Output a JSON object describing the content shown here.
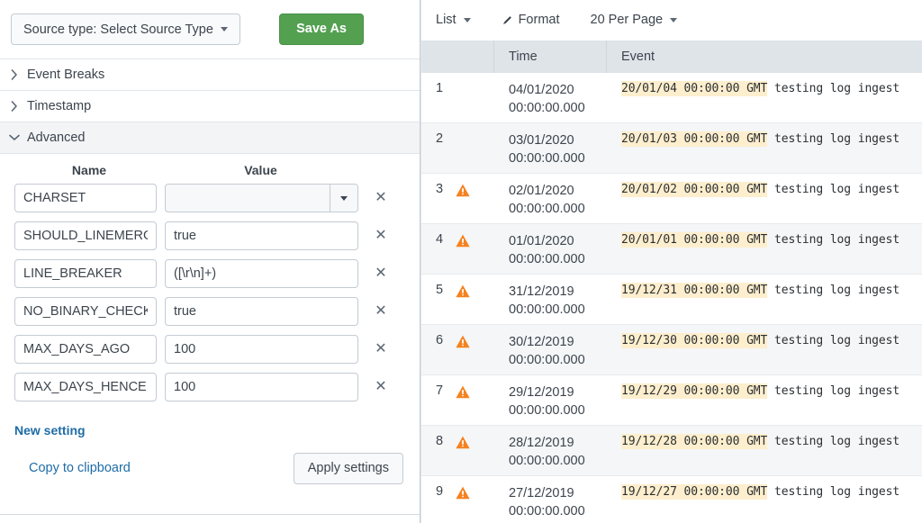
{
  "left_panel": {
    "source_type": {
      "label": "Source type: Select Source Type",
      "caret_icon": "chevron-down-icon"
    },
    "save_as_label": "Save As",
    "accent_green": "#53a051",
    "link_blue": "#1e6ca6",
    "accordion": [
      {
        "label": "Event Breaks",
        "expanded": false,
        "icon": "chevron-right-icon"
      },
      {
        "label": "Timestamp",
        "expanded": false,
        "icon": "chevron-right-icon"
      },
      {
        "label": "Advanced",
        "expanded": true,
        "icon": "chevron-down-icon"
      }
    ],
    "advanced": {
      "col_name_header": "Name",
      "col_value_header": "Value",
      "remove_icon": "close-icon",
      "dropdown_icon": "chevron-down-icon",
      "settings": [
        {
          "name": "CHARSET",
          "value": "",
          "type": "select"
        },
        {
          "name": "SHOULD_LINEMERGE",
          "value": "true",
          "type": "text"
        },
        {
          "name": "LINE_BREAKER",
          "value": "([\\r\\n]+)",
          "type": "text"
        },
        {
          "name": "NO_BINARY_CHECK",
          "value": "true",
          "type": "text"
        },
        {
          "name": "MAX_DAYS_AGO",
          "value": "100",
          "type": "text"
        },
        {
          "name": "MAX_DAYS_HENCE",
          "value": "100",
          "type": "text"
        }
      ],
      "new_setting_label": "New setting",
      "copy_to_clipboard_label": "Copy to clipboard",
      "apply_settings_label": "Apply settings"
    }
  },
  "right_panel": {
    "toolbar": {
      "view_mode": "List",
      "view_mode_icon": "chevron-down-icon",
      "format_label": "Format",
      "format_icon": "pencil-icon",
      "per_page": "20 Per Page",
      "per_page_icon": "chevron-down-icon"
    },
    "table": {
      "columns": [
        "",
        "",
        "Time",
        "Event"
      ],
      "warning_icon": "warning-triangle-icon",
      "warning_color": "#f58220",
      "highlight_color": "#fdeecd",
      "rows": [
        {
          "num": "1",
          "warning": false,
          "time_date": "04/01/2020",
          "time_clock": "00:00:00.000",
          "event_ts": "20/01/04 00:00:00 GMT",
          "event_msg": "testing log ingest"
        },
        {
          "num": "2",
          "warning": false,
          "time_date": "03/01/2020",
          "time_clock": "00:00:00.000",
          "event_ts": "20/01/03 00:00:00 GMT",
          "event_msg": "testing log ingest"
        },
        {
          "num": "3",
          "warning": true,
          "time_date": "02/01/2020",
          "time_clock": "00:00:00.000",
          "event_ts": "20/01/02 00:00:00 GMT",
          "event_msg": "testing log ingest"
        },
        {
          "num": "4",
          "warning": true,
          "time_date": "01/01/2020",
          "time_clock": "00:00:00.000",
          "event_ts": "20/01/01 00:00:00 GMT",
          "event_msg": "testing log ingest"
        },
        {
          "num": "5",
          "warning": true,
          "time_date": "31/12/2019",
          "time_clock": "00:00:00.000",
          "event_ts": "19/12/31 00:00:00 GMT",
          "event_msg": "testing log ingest"
        },
        {
          "num": "6",
          "warning": true,
          "time_date": "30/12/2019",
          "time_clock": "00:00:00.000",
          "event_ts": "19/12/30 00:00:00 GMT",
          "event_msg": "testing log ingest"
        },
        {
          "num": "7",
          "warning": true,
          "time_date": "29/12/2019",
          "time_clock": "00:00:00.000",
          "event_ts": "19/12/29 00:00:00 GMT",
          "event_msg": "testing log ingest"
        },
        {
          "num": "8",
          "warning": true,
          "time_date": "28/12/2019",
          "time_clock": "00:00:00.000",
          "event_ts": "19/12/28 00:00:00 GMT",
          "event_msg": "testing log ingest"
        },
        {
          "num": "9",
          "warning": true,
          "time_date": "27/12/2019",
          "time_clock": "00:00:00.000",
          "event_ts": "19/12/27 00:00:00 GMT",
          "event_msg": "testing log ingest"
        }
      ]
    }
  }
}
